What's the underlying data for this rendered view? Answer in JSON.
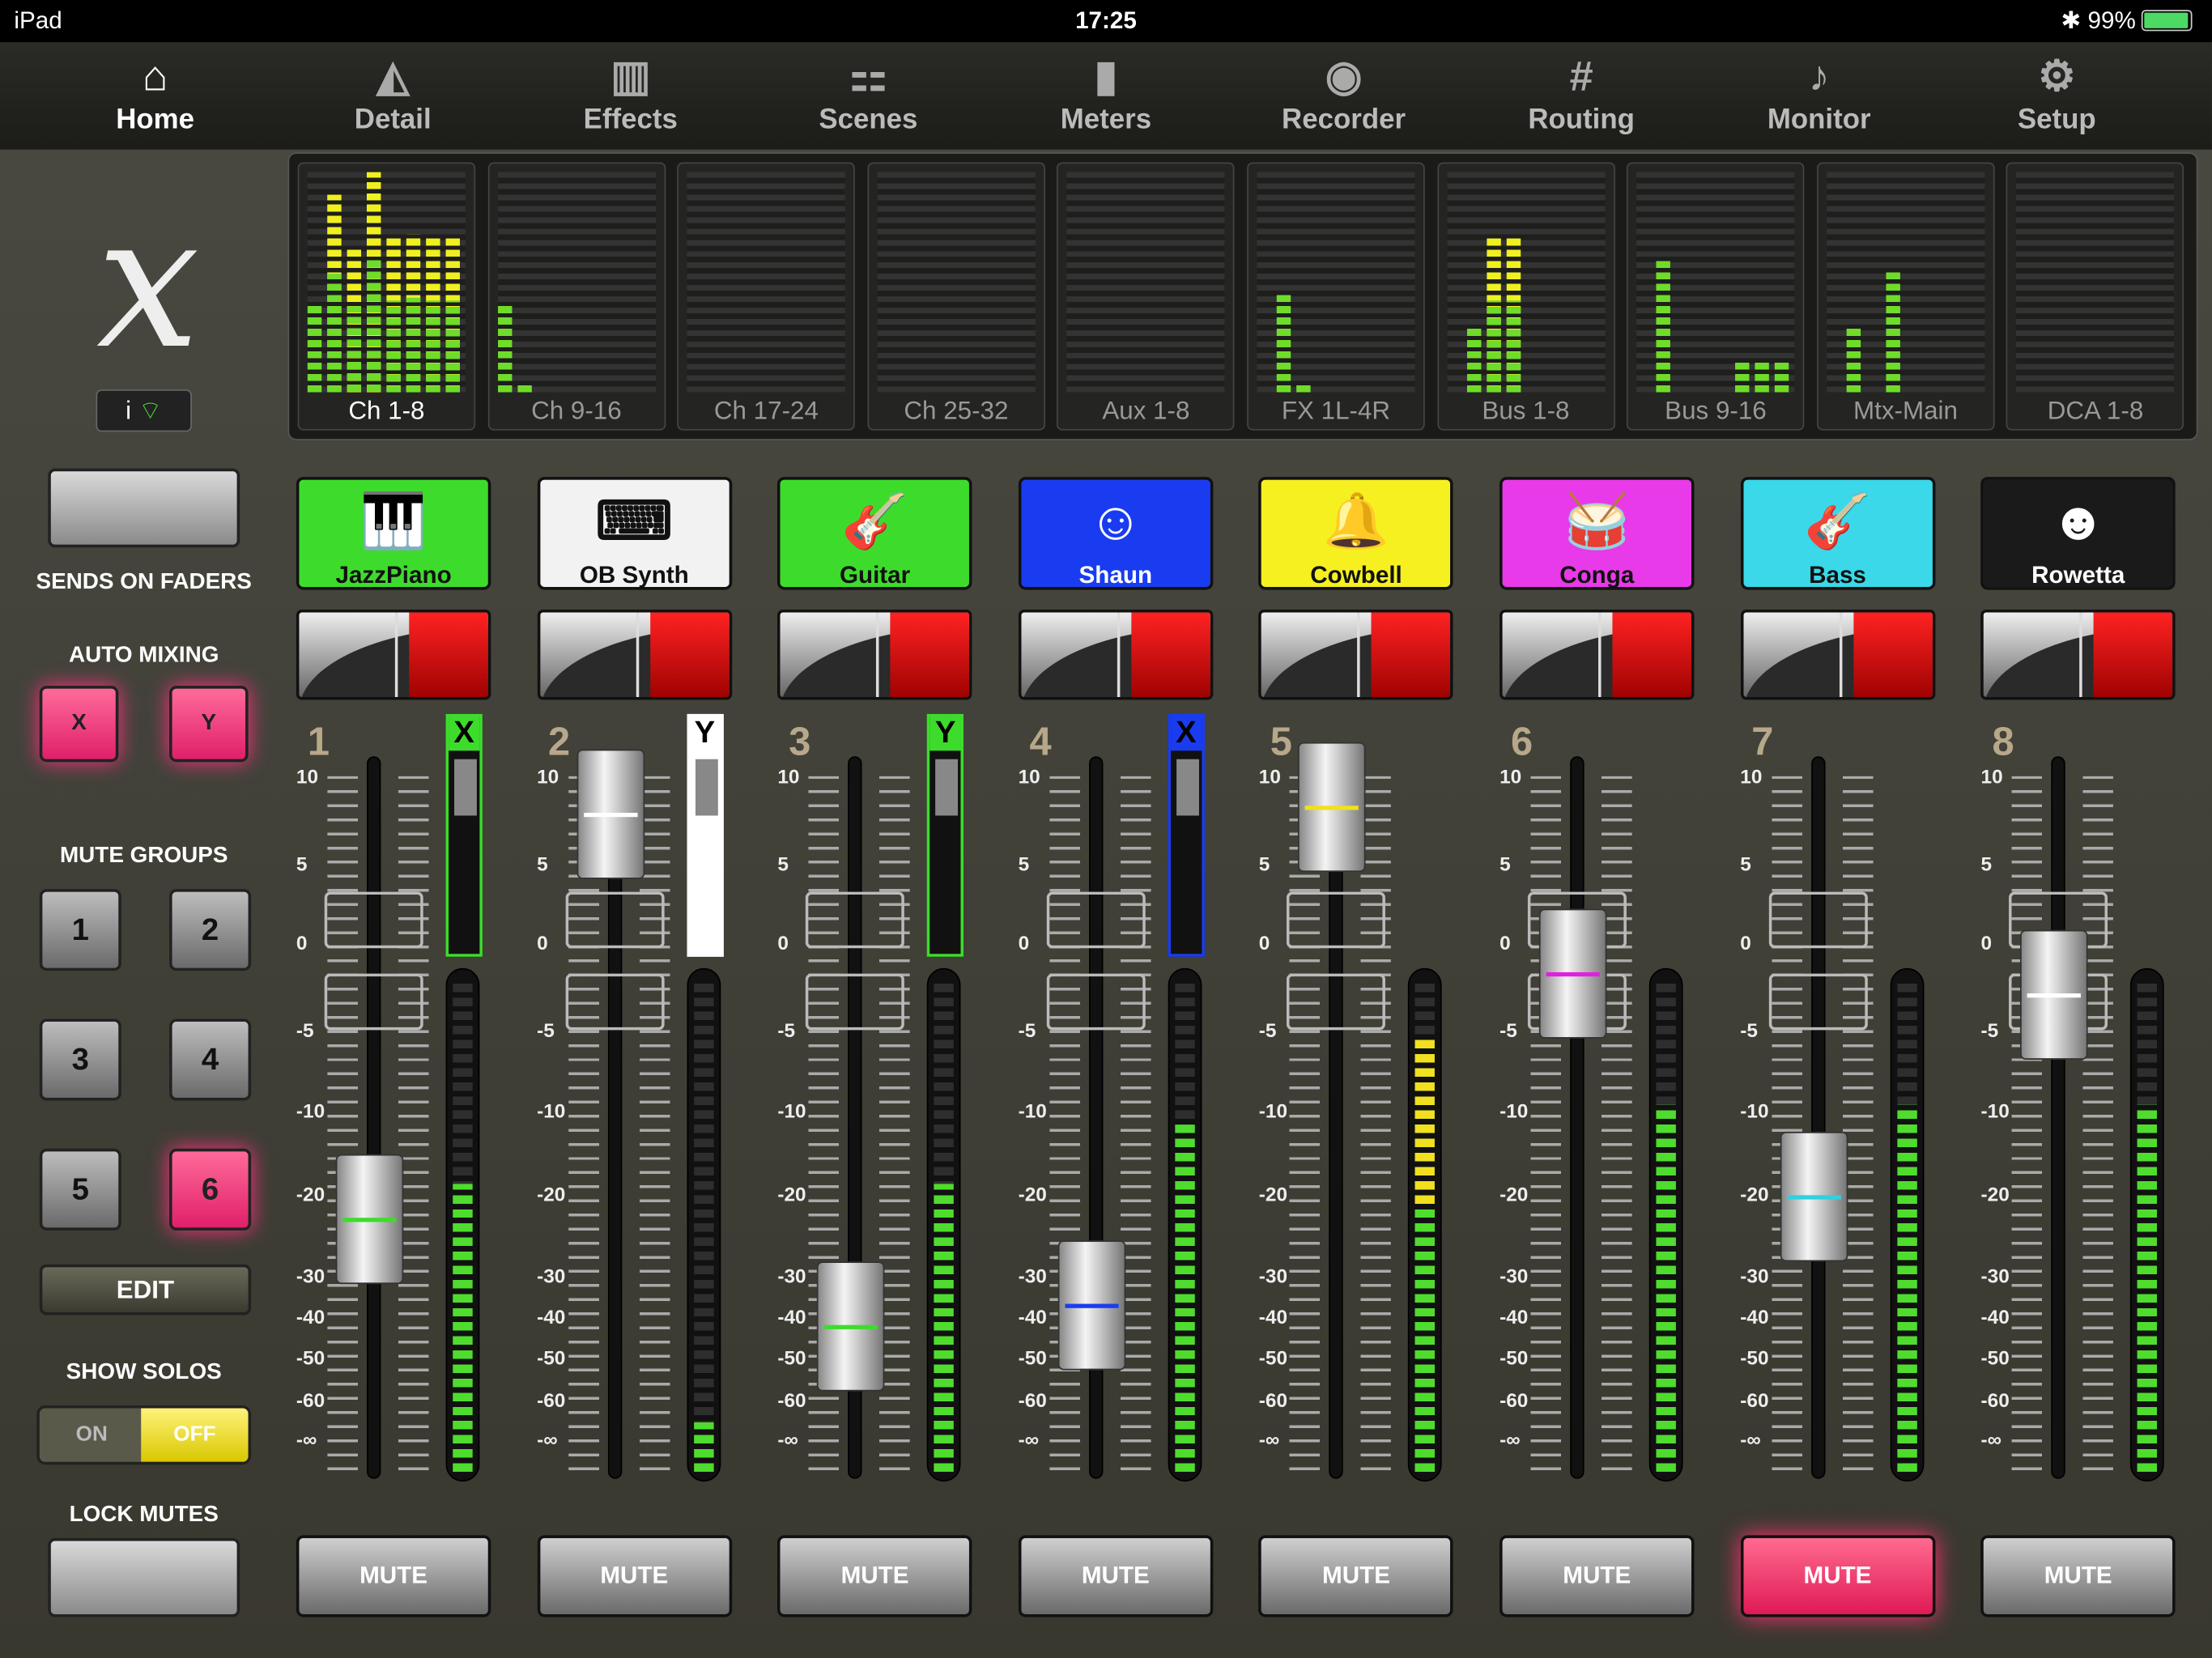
{
  "status": {
    "device": "iPad",
    "time": "17:25",
    "battery": "99%"
  },
  "tabs": [
    {
      "label": "Home",
      "icon": "home-icon",
      "glyph": "⌂"
    },
    {
      "label": "Detail",
      "icon": "detail-icon",
      "glyph": "◭"
    },
    {
      "label": "Effects",
      "icon": "effects-icon",
      "glyph": "▥"
    },
    {
      "label": "Scenes",
      "icon": "scenes-icon",
      "glyph": "⚏"
    },
    {
      "label": "Meters",
      "icon": "meters-icon",
      "glyph": "▮"
    },
    {
      "label": "Recorder",
      "icon": "recorder-icon",
      "glyph": "◉"
    },
    {
      "label": "Routing",
      "icon": "routing-icon",
      "glyph": "#"
    },
    {
      "label": "Monitor",
      "icon": "monitor-icon",
      "glyph": "♪"
    },
    {
      "label": "Setup",
      "icon": "setup-icon",
      "glyph": "⚙"
    }
  ],
  "meter_banks": [
    {
      "label": "Ch 1-8",
      "selected": true
    },
    {
      "label": "Ch 9-16"
    },
    {
      "label": "Ch 17-24"
    },
    {
      "label": "Ch 25-32"
    },
    {
      "label": "Aux 1-8"
    },
    {
      "label": "FX 1L-4R"
    },
    {
      "label": "Bus 1-8"
    },
    {
      "label": "Bus 9-16"
    },
    {
      "label": "Mtx-Main"
    },
    {
      "label": "DCA 1-8"
    }
  ],
  "left": {
    "logo": "x",
    "info": "i",
    "sends_on_faders": "SENDS ON FADERS",
    "auto_mixing": "AUTO MIXING",
    "auto_x": "X",
    "auto_y": "Y",
    "mute_groups": "MUTE GROUPS",
    "groups": [
      "1",
      "2",
      "3",
      "4",
      "5",
      "6"
    ],
    "active_group": "6",
    "edit": "EDIT",
    "show_solos": "SHOW SOLOS",
    "on": "ON",
    "off": "OFF",
    "lock_mutes": "LOCK MUTES"
  },
  "scale_labels": [
    "10",
    "5",
    "0",
    "-5",
    "-10",
    "-20",
    "-30",
    "-40",
    "-50",
    "-60",
    "-∞"
  ],
  "channels": [
    {
      "num": "1",
      "name": "JazzPiano",
      "color": "#3ddc2c",
      "icon": "piano-icon",
      "glyph": "🎹",
      "group": "X",
      "group_color": "#3ddc2c",
      "fader_level": 0.36,
      "mark_color": "#3ddc2c",
      "meter_level": 0.58,
      "mute": "MUTE",
      "muted": false
    },
    {
      "num": "2",
      "name": "OB Synth",
      "color": "#f2f2f2",
      "icon": "synth-icon",
      "glyph": "⌨",
      "group": "Y",
      "group_color": "#ffffff",
      "fader_level": 0.92,
      "mark_color": "#ffffff",
      "meter_level": 0.1,
      "mute": "MUTE",
      "muted": false
    },
    {
      "num": "3",
      "name": "Guitar",
      "color": "#3ddc2c",
      "icon": "guitar-icon",
      "glyph": "🎸",
      "group": "Y",
      "group_color": "#3ddc2c",
      "fader_level": 0.21,
      "mark_color": "#3ddc2c",
      "meter_level": 0.58,
      "mute": "MUTE",
      "muted": false
    },
    {
      "num": "4",
      "name": "Shaun",
      "color": "#1a3cf0",
      "icon": "person-icon",
      "glyph": "☺",
      "group": "X",
      "group_color": "#1a3cf0",
      "fader_level": 0.24,
      "mark_color": "#1a3cf0",
      "meter_level": 0.7,
      "mute": "MUTE",
      "muted": false
    },
    {
      "num": "5",
      "name": "Cowbell",
      "color": "#f6f020",
      "icon": "cowbell-icon",
      "glyph": "🔔",
      "group": "",
      "group_color": "",
      "fader_level": 0.93,
      "mark_color": "#f0e020",
      "meter_level": 0.88,
      "mute": "MUTE",
      "muted": false
    },
    {
      "num": "6",
      "name": "Conga",
      "color": "#e83ae8",
      "icon": "conga-icon",
      "glyph": "🥁",
      "group": "",
      "group_color": "",
      "fader_level": 0.7,
      "mark_color": "#e020e0",
      "meter_level": 0.74,
      "mute": "MUTE",
      "muted": false
    },
    {
      "num": "7",
      "name": "Bass",
      "color": "#3ad8e8",
      "icon": "bass-icon",
      "glyph": "🎸",
      "group": "",
      "group_color": "",
      "fader_level": 0.39,
      "mark_color": "#30d0e0",
      "meter_level": 0.74,
      "mute": "MUTE",
      "muted": true
    },
    {
      "num": "8",
      "name": "Rowetta",
      "color": "#1a1a1a",
      "icon": "singer-icon",
      "glyph": "☻",
      "group": "",
      "group_color": "",
      "fader_level": 0.67,
      "mark_color": "#ffffff",
      "meter_level": 0.74,
      "mute": "MUTE",
      "muted": false
    }
  ]
}
